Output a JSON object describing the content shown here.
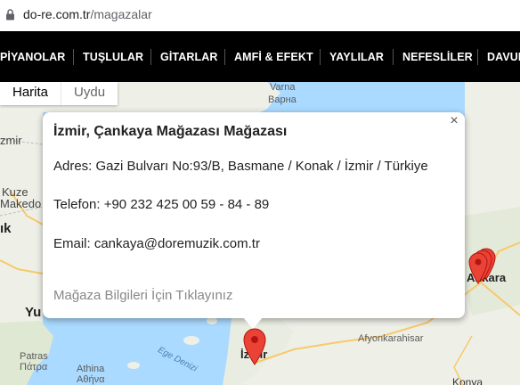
{
  "browser": {
    "url_host": "do-re.com.tr",
    "url_path": "/magazalar"
  },
  "nav": {
    "items": [
      "PİYANOLAR",
      "TUŞLULAR",
      "GİTARLAR",
      "AMFİ & EFEKT",
      "YAYLILAR",
      "NEFESLİLER",
      "DAVUL"
    ]
  },
  "map": {
    "map_type": {
      "map": "Harita",
      "satellite": "Uydu"
    },
    "labels": {
      "varna": "Varna",
      "varna_cyr": "Варна",
      "izmir_left": "zmir",
      "kuze": "Kuze",
      "makedo": "Makedo",
      "ik": "ık",
      "yu": "Yu",
      "patras": "Patras",
      "patra_gr": "Πάτρα",
      "athina": "Athina",
      "athina_gr": "Αθήνα",
      "ege": "Ege Denizi",
      "izmir_city": "İzmir",
      "ankara": "Ankara",
      "afyon": "Afyonkarahisar",
      "konya": "Konya"
    },
    "colors": {
      "land": "#eef0e8",
      "sea": "#aadaff",
      "pin": "#ea4335"
    }
  },
  "infowindow": {
    "close": "×",
    "title": "İzmir, Çankaya Mağazası Mağazası",
    "address": "Adres: Gazi Bulvarı No:93/B, Basmane / Konak / İzmir / Türkiye",
    "phone": "Telefon: +90 232 425 00 59 - 84 - 89",
    "email": "Email: cankaya@doremuzik.com.tr",
    "link": "Mağaza Bilgileri İçin Tıklayınız"
  }
}
